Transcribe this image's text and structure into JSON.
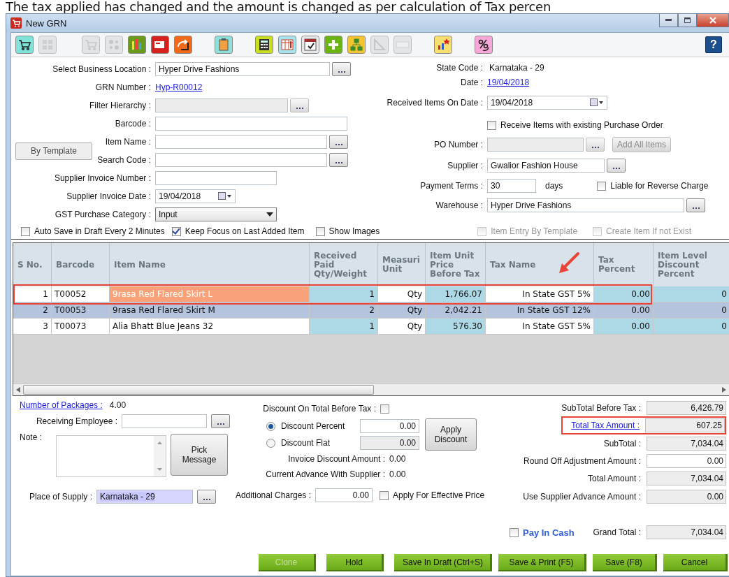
{
  "caption": "The tax applied has changed and the amount is changed as per calculation of Tax percen",
  "window": {
    "title": "New GRN"
  },
  "toolbar": [
    [
      {
        "kind": "cart",
        "disabled": false
      },
      {
        "kind": "grid",
        "disabled": true
      }
    ],
    [
      {
        "kind": "cart",
        "disabled": true
      },
      {
        "kind": "dots",
        "disabled": true
      },
      {
        "kind": "bar-chart",
        "disabled": false
      },
      {
        "kind": "card",
        "disabled": false
      },
      {
        "kind": "arrows",
        "disabled": false
      }
    ],
    [
      {
        "kind": "clipboard",
        "disabled": false
      }
    ],
    [
      {
        "kind": "calculator",
        "disabled": false
      },
      {
        "kind": "table",
        "disabled": false
      },
      {
        "kind": "calendar",
        "disabled": false
      },
      {
        "kind": "plus",
        "disabled": false
      },
      {
        "kind": "hierarchy",
        "disabled": false
      },
      {
        "kind": "triangle",
        "disabled": true
      },
      {
        "kind": "keypad",
        "disabled": true
      }
    ],
    [
      {
        "kind": "chart",
        "disabled": false
      }
    ],
    [
      {
        "kind": "percent",
        "disabled": false
      }
    ]
  ],
  "help_button": "?",
  "by_template_button": "By Template",
  "left_form": [
    {
      "label": "Select Business Location :",
      "kind": "input-browse",
      "value": "Hyper Drive Fashions",
      "disabled": false
    },
    {
      "label": "GRN Number :",
      "kind": "link",
      "value": "Hyp-R00012",
      "disabled": false
    },
    {
      "label": "Filter Hierarchy  :",
      "kind": "input-browse",
      "disabled": true
    },
    {
      "label": "Barcode :",
      "kind": "input",
      "disabled": false
    },
    {
      "label": "Item Name :",
      "kind": "input-browse",
      "disabled": false
    },
    {
      "label": "Search Code :",
      "kind": "input-browse",
      "disabled": false
    },
    {
      "label": "Supplier Invoice Number :",
      "kind": "input",
      "disabled": false
    },
    {
      "label": "Supplier Invoice Date :",
      "kind": "date",
      "value": "19/04/2018",
      "disabled": false
    },
    {
      "label": "GST Purchase Category :",
      "kind": "select",
      "value": "Input",
      "disabled": false
    }
  ],
  "right_form": [
    {
      "label": "State Code :",
      "kind": "text",
      "value": "Karnataka - 29",
      "disabled": false
    },
    {
      "label": "Date :",
      "kind": "link",
      "value": "19/04/2018",
      "disabled": false
    },
    {
      "label": "Received Items On Date :",
      "kind": "date",
      "value": "19/04/2018",
      "disabled": false
    },
    {
      "kind": "checkbox",
      "text": "Receive Items with existing Purchase Order",
      "checked": false,
      "disabled": false
    },
    {
      "label": "PO Number :",
      "kind": "input-browse",
      "disabled": true,
      "button": "Add All Items"
    },
    {
      "label": "Supplier :",
      "kind": "input-browse",
      "value": "Gwalior Fashion House",
      "disabled": false
    },
    {
      "label": "Payment Terms :",
      "kind": "terms",
      "value": "30",
      "unit": "days",
      "disabled": false,
      "option": {
        "text": "Liable for Reverse Charge",
        "checked": false
      }
    },
    {
      "label": "Warehouse :",
      "kind": "input-browse",
      "value": "Hyper Drive Fashions",
      "disabled": false
    }
  ],
  "options": [
    {
      "text": "Auto Save in Draft Every 2 Minutes",
      "checked": false,
      "disabled": false
    },
    {
      "text": "Keep Focus on Last Added Item",
      "checked": true,
      "disabled": false
    },
    {
      "text": "Show Images",
      "checked": false,
      "disabled": false
    },
    {
      "text": "Item Entry By Template",
      "checked": false,
      "disabled": true
    },
    {
      "text": "Create Item If not Exist",
      "checked": false,
      "disabled": true
    }
  ],
  "table": {
    "columns": [
      {
        "label": "S No.",
        "editable": false,
        "marked": false
      },
      {
        "label": "Barcode",
        "editable": false,
        "marked": false
      },
      {
        "label": "Item Name",
        "editable": false,
        "marked": false
      },
      {
        "label": "Received Paid Qty/Weight",
        "editable": true,
        "marked": false
      },
      {
        "label": "Measuri Unit",
        "editable": false,
        "marked": false
      },
      {
        "label": "Item Unit Price Before Tax",
        "editable": true,
        "marked": false
      },
      {
        "label": "Tax Name",
        "editable": false,
        "marked": true
      },
      {
        "label": "Tax Percent",
        "editable": true,
        "marked": false
      },
      {
        "label": "Item Level Discount Percent",
        "editable": true,
        "marked": false
      }
    ],
    "rows": [
      {
        "cells": [
          "1",
          "T00052",
          "9rasa Red Flared Skirt  L",
          "1",
          "Qty",
          "1,766.07",
          "In State GST 5%",
          "0.00",
          "0"
        ],
        "selected": false,
        "current": true,
        "highlighted": true
      },
      {
        "cells": [
          "2",
          "T00053",
          "9rasa Red Flared Skirt  M",
          "2",
          "Qty",
          "2,042.21",
          "In State GST 12%",
          "0.00",
          "0"
        ],
        "selected": true,
        "current": false
      },
      {
        "cells": [
          "3",
          "T00073",
          "Alia Bhatt Blue Jeans  32",
          "1",
          "Qty",
          "576.30",
          "In State GST 5%",
          "0.00",
          "0"
        ],
        "selected": false,
        "current": false
      }
    ]
  },
  "packages": {
    "label": "Number of Packages :",
    "value": "4.00"
  },
  "receiving_employee": {
    "label": "Receiving Employee :"
  },
  "note": {
    "label": "Note :"
  },
  "pick_message_button": "Pick Message",
  "place_of_supply": {
    "label": "Place of Supply :",
    "value": "Karnataka - 29"
  },
  "discount": {
    "label": "Discount On Total Before Tax :",
    "checked": false,
    "modes": [
      {
        "text": "Discount Percent",
        "selected": true,
        "value": "0.00"
      },
      {
        "text": "Discount Flat",
        "selected": false,
        "value": "0.00"
      }
    ],
    "apply_button": "Apply Discount"
  },
  "amounts": [
    {
      "label": "Invoice Discount Amount :",
      "value": "0.00"
    },
    {
      "label": "Current Advance With Supplier :",
      "value": "0.00"
    }
  ],
  "additional_charges": {
    "label": "Additional Charges :",
    "value": "0.00"
  },
  "effective_price": {
    "text": "Apply For Effective Price",
    "checked": false
  },
  "totals": [
    {
      "label": "SubTotal Before Tax :",
      "value": "6,426.79",
      "kind": "readonly",
      "highlighted": false
    },
    {
      "label": "Total Tax Amount :",
      "value": "607.25",
      "kind": "link",
      "highlighted": true
    },
    {
      "label": "SubTotal :",
      "value": "7,034.04",
      "kind": "readonly",
      "highlighted": false
    },
    {
      "label": "Round Off Adjustment Amount :",
      "value": "0.00",
      "kind": "input",
      "highlighted": false
    },
    {
      "label": "Total Amount :",
      "value": "7,034.04",
      "kind": "readonly",
      "highlighted": false
    },
    {
      "label": "Use Supplier Advance Amount :",
      "value": "0.00",
      "kind": "readonly",
      "highlighted": false
    }
  ],
  "pay_in_cash": {
    "text": "Pay In Cash",
    "checked": false
  },
  "grand_total": {
    "label": "Grand Total :",
    "value": "7,034.04"
  },
  "buttons": [
    {
      "label": "Clone",
      "disabled": true
    },
    {
      "label": "Hold",
      "disabled": false
    },
    {
      "label": "Save In Draft (Ctrl+S)",
      "disabled": false
    },
    {
      "label": "Save & Print (F5)",
      "disabled": false
    },
    {
      "label": "Save (F8)",
      "disabled": false
    },
    {
      "label": "Cancel",
      "disabled": false
    }
  ]
}
